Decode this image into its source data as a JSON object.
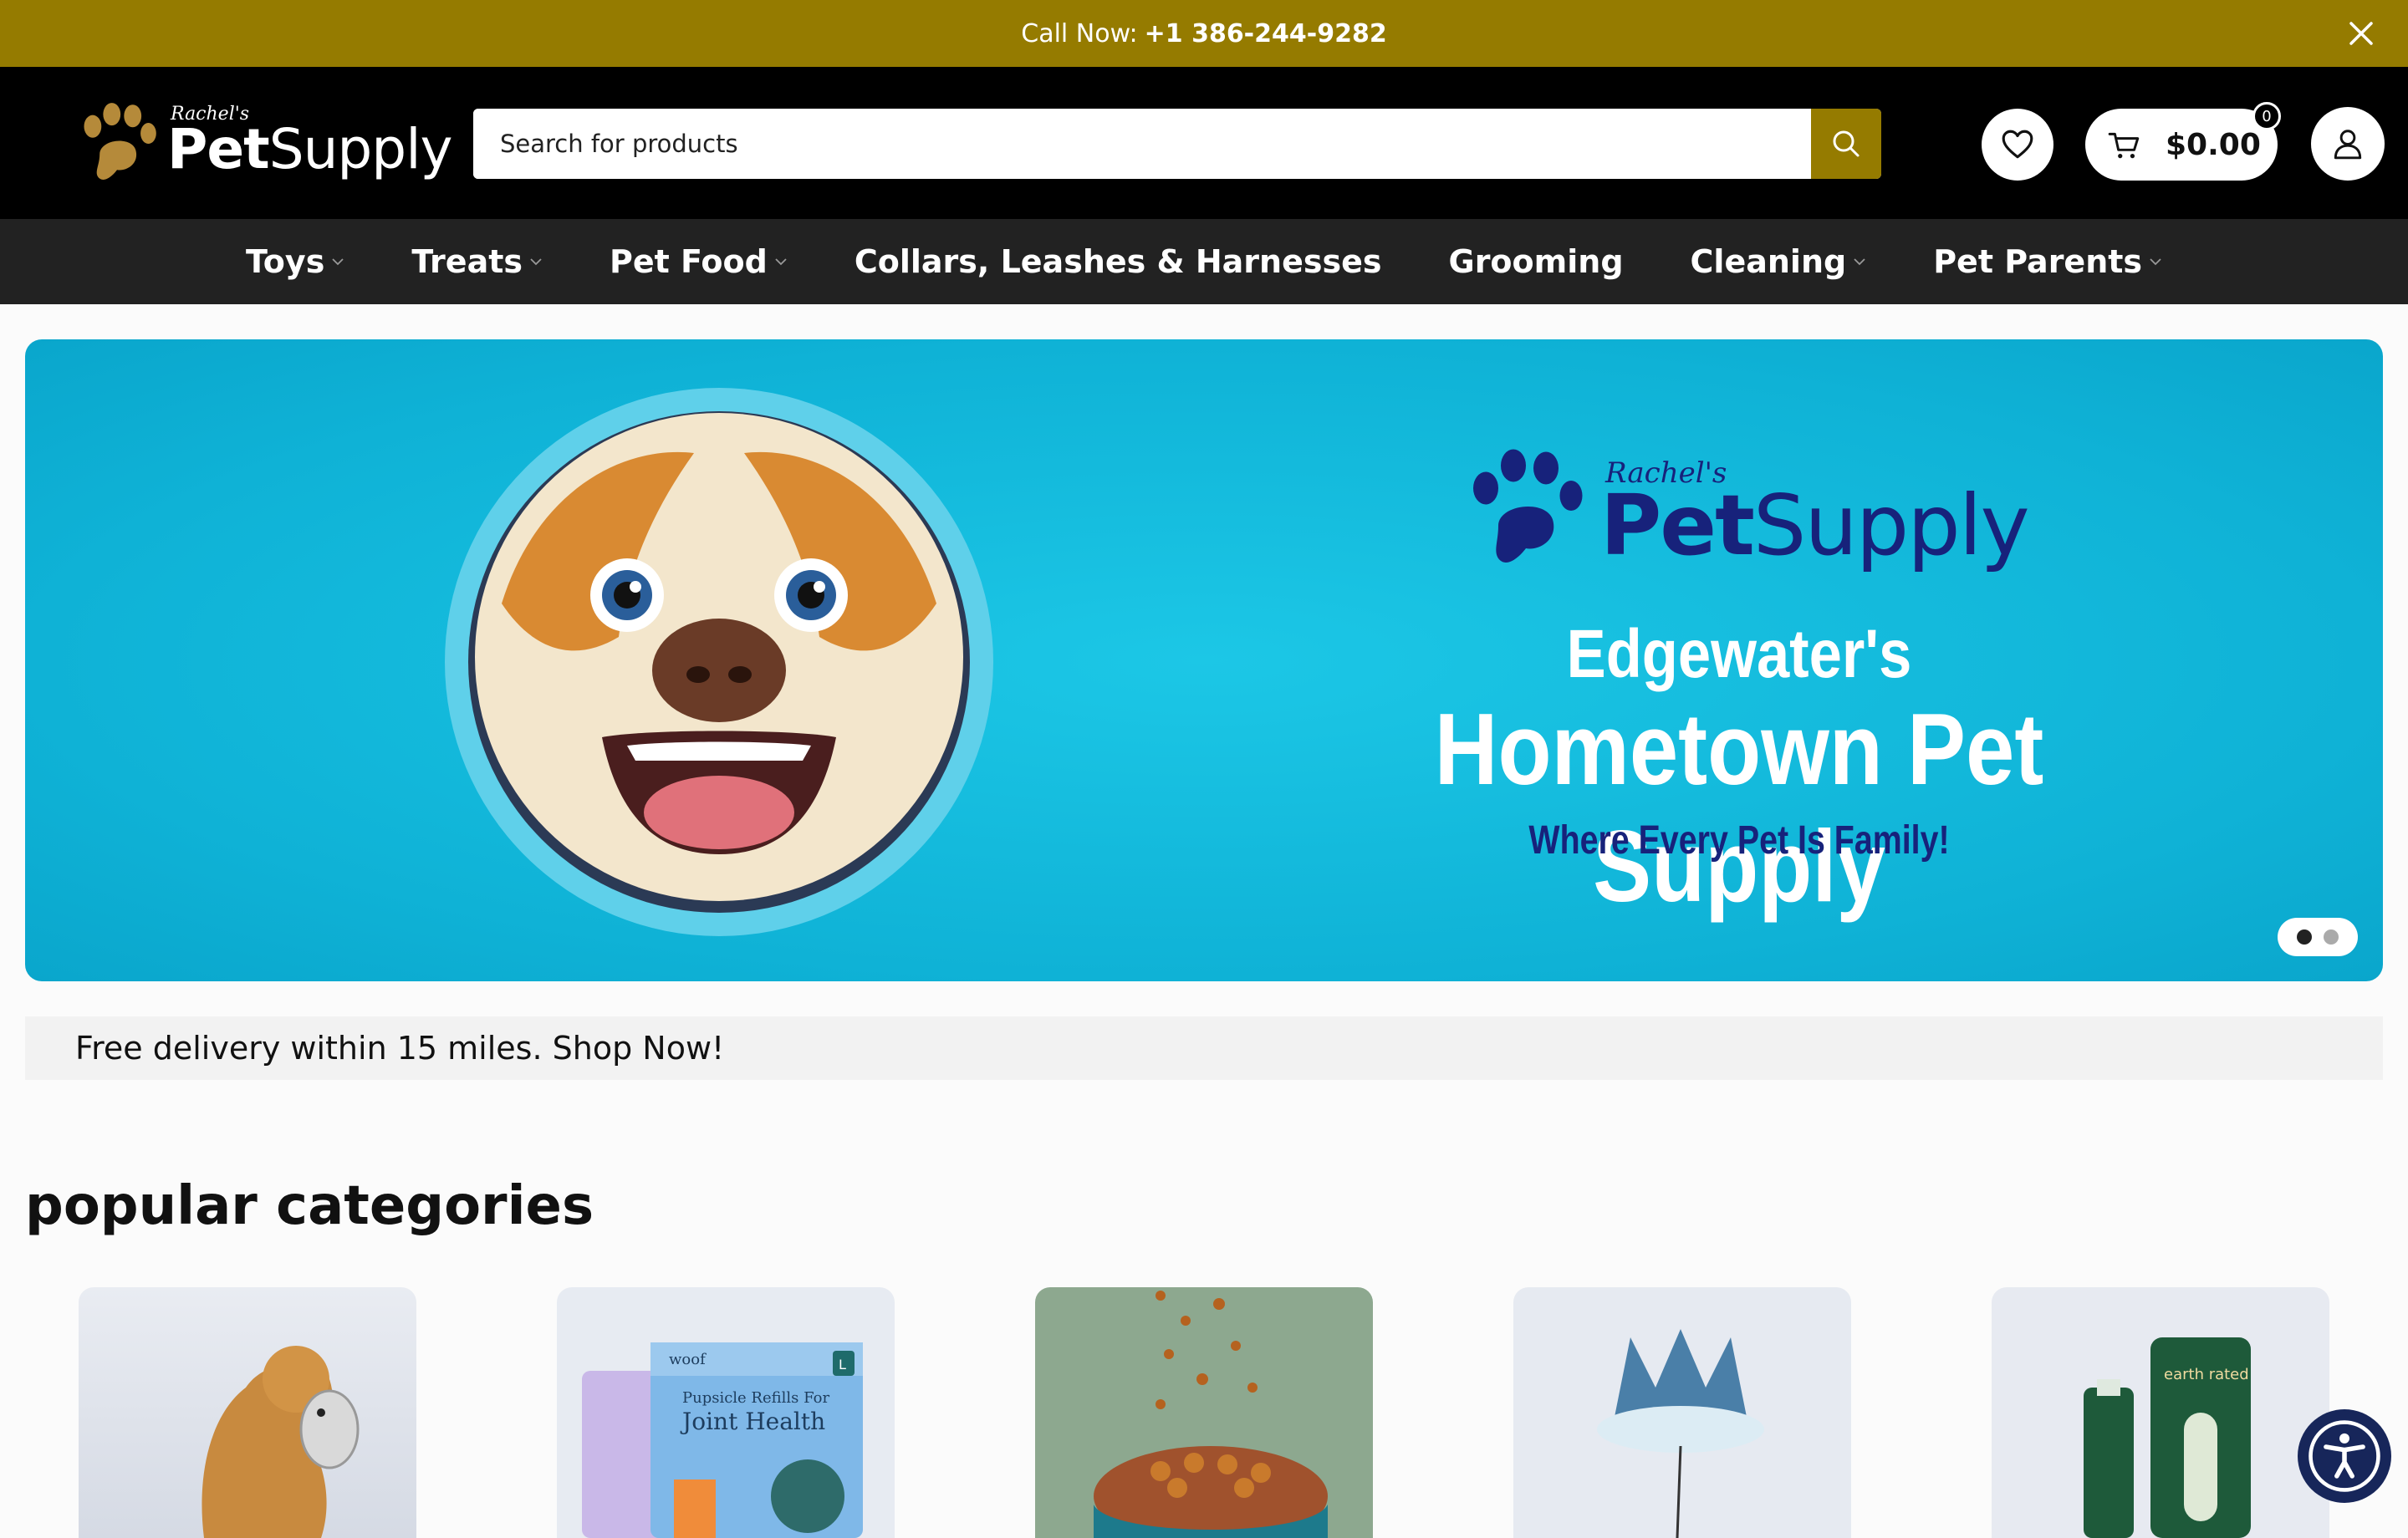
{
  "topbar": {
    "call_label": "Call Now:",
    "phone": "+1 386-244-9282",
    "close_icon": "close-icon"
  },
  "header": {
    "logo_script": "Rachel's",
    "logo_word_bold": "Pet",
    "logo_word_light": "Supply",
    "search_placeholder": "Search for products",
    "search_icon": "search-icon",
    "wishlist_icon": "heart-icon",
    "cart_icon": "cart-icon",
    "cart_total": "$0.00",
    "cart_count": "0",
    "account_icon": "user-icon"
  },
  "nav": {
    "items": [
      {
        "label": "Toys",
        "dropdown": true
      },
      {
        "label": "Treats",
        "dropdown": true
      },
      {
        "label": "Pet Food",
        "dropdown": true
      },
      {
        "label": "Collars, Leashes & Harnesses",
        "dropdown": false
      },
      {
        "label": "Grooming",
        "dropdown": false
      },
      {
        "label": "Cleaning",
        "dropdown": true
      },
      {
        "label": "Pet Parents",
        "dropdown": true
      }
    ]
  },
  "hero": {
    "logo_script": "Rachel's",
    "logo_word_bold": "Pet",
    "logo_word_light": "Supply",
    "line1": "Edgewater's",
    "line2": "Hometown Pet Supply",
    "line3": "Where Every Pet Is Family!",
    "slides": 2,
    "active_slide": 1,
    "background_color": "#10b8dc"
  },
  "delivery_strip": {
    "text": "Free delivery within 15 miles. Shop Now!"
  },
  "popular_categories": {
    "title": "popular categories",
    "items": [
      {
        "image": "dog-with-plush-toy"
      },
      {
        "image": "woof-pupsicle-refills",
        "package_brand": "woof",
        "package_title_1": "Pupsicle Refills For",
        "package_title_2": "Joint Health",
        "package_size": "L"
      },
      {
        "image": "kibble-bowl"
      },
      {
        "image": "party-crown"
      },
      {
        "image": "earth-rated-cleaning",
        "brand": "earth rated"
      }
    ]
  },
  "accessibility": {
    "icon": "accessibility-icon"
  },
  "colors": {
    "brand_gold": "#957b00",
    "header_black": "#000000",
    "nav_dark": "#222222",
    "hero_navy": "#17227b"
  }
}
